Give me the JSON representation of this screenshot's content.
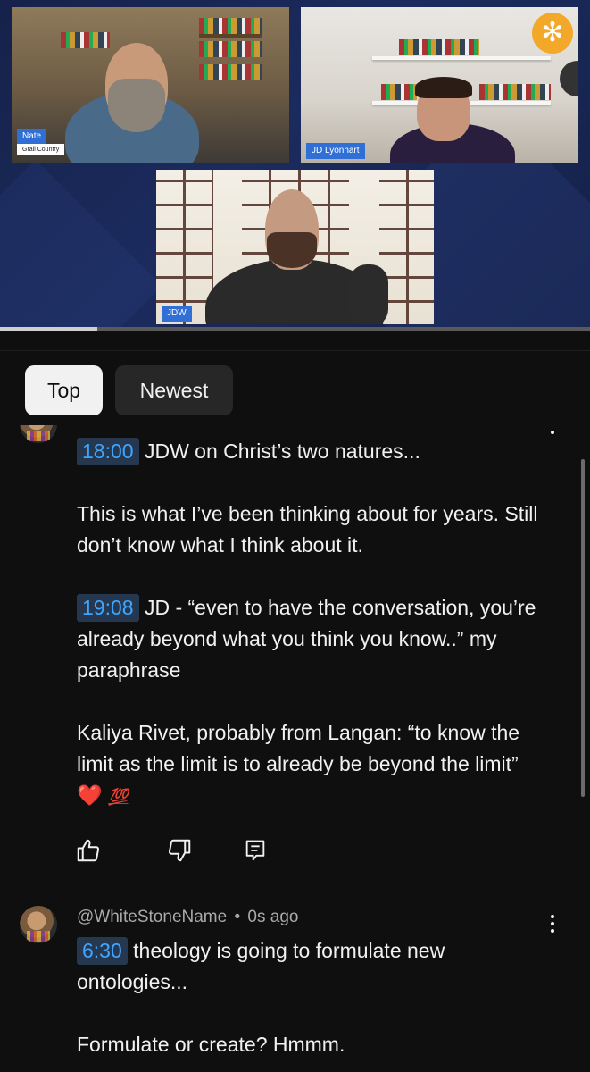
{
  "video": {
    "participants": [
      {
        "name": "Nate",
        "subtitle": "Grail Country"
      },
      {
        "name": "JD Lyonhart"
      },
      {
        "name": "JDW"
      }
    ],
    "logo_icon": "asterisk-flower-icon",
    "progress_fraction": 0.165
  },
  "filters": {
    "top": "Top",
    "newest": "Newest",
    "selected": "Top"
  },
  "comments": [
    {
      "paragraphs": [
        {
          "timestamp": "18:00",
          "text": " JDW on Christ’s two natures..."
        },
        {
          "text": "This is what I’ve been thinking about for years. Still don’t know what I think about it."
        },
        {
          "timestamp": "19:08",
          "text": " JD - “even to have the conversation, you’re already beyond what you think you know..” my paraphrase"
        },
        {
          "text": "Kaliya Rivet, probably from Langan: “to know the limit as the limit is to already be beyond the limit”",
          "emoji": [
            "❤️",
            "💯"
          ]
        }
      ],
      "actions": [
        "like-icon",
        "dislike-icon",
        "reply-icon"
      ]
    },
    {
      "author": "@WhiteStoneName",
      "separator": "•",
      "time": "0s ago",
      "paragraphs": [
        {
          "timestamp": "6:30",
          "text": " theology is going to formulate new ontologies..."
        },
        {
          "text": "Formulate or create? Hmmm."
        }
      ]
    }
  ],
  "colors": {
    "timestamp_text": "#3ea6ff",
    "timestamp_bg": "#263850",
    "background": "#0f0f0f",
    "name_tag": "#2f6fd6"
  }
}
